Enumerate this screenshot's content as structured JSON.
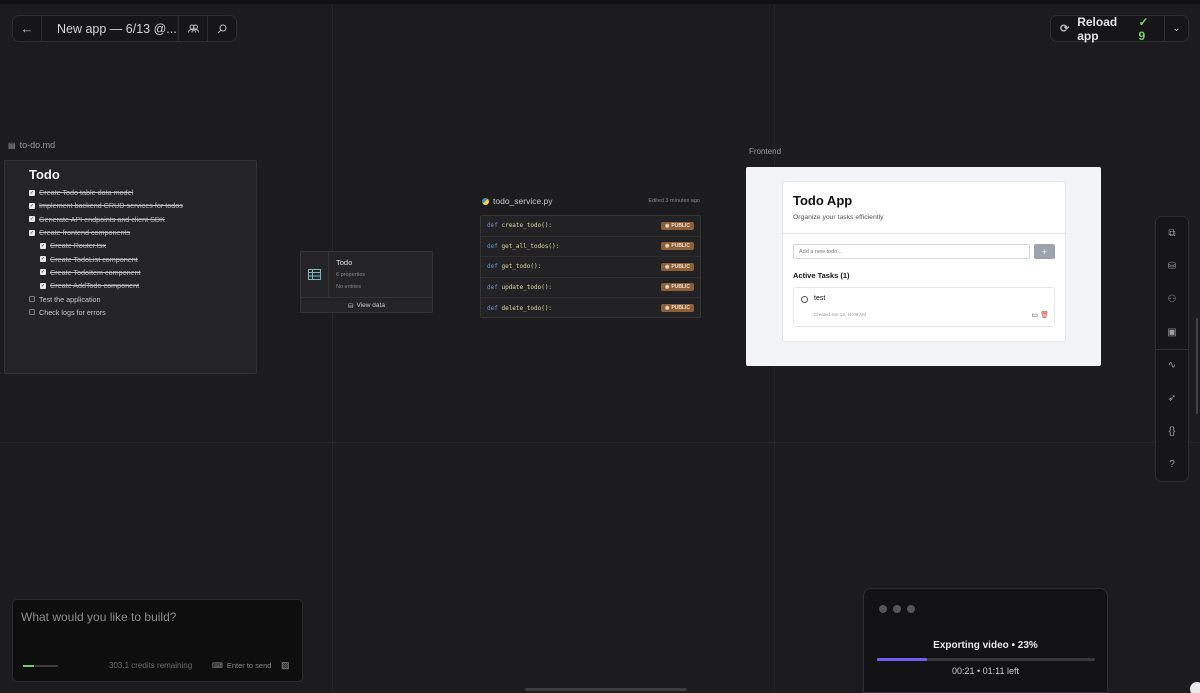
{
  "topbar": {
    "app_title": "New app — 6/13 @..."
  },
  "reload": {
    "label": "Reload app",
    "count": "9"
  },
  "markdown_node": {
    "filename": "to-do.md",
    "title": "Todo",
    "items": [
      {
        "text": "Create Todo table data model",
        "done": true,
        "sub": false
      },
      {
        "text": "Implement backend CRUD services for todos",
        "done": true,
        "sub": false
      },
      {
        "text": "Generate API endpoints and client SDK",
        "done": true,
        "sub": false
      },
      {
        "text": "Create frontend components",
        "done": true,
        "sub": false
      },
      {
        "text": "Create Router.tsx",
        "done": true,
        "sub": true
      },
      {
        "text": "Create TodoList component",
        "done": true,
        "sub": true
      },
      {
        "text": "Create TodoItem component",
        "done": true,
        "sub": true
      },
      {
        "text": "Create AddTodo component",
        "done": true,
        "sub": true
      },
      {
        "text": "Test the application",
        "done": false,
        "sub": false
      },
      {
        "text": "Check logs for errors",
        "done": false,
        "sub": false
      }
    ]
  },
  "table_node": {
    "name": "Todo",
    "properties": "6 properties",
    "entries": "No entries",
    "view_label": "View data"
  },
  "service_node": {
    "filename": "todo_service.py",
    "edited": "Edited 3 minutes ago",
    "keyword": "def",
    "badge": "PUBLIC",
    "functions": [
      "create_todo():",
      "get_all_todos():",
      "get_todo():",
      "update_todo():",
      "delete_todo():"
    ]
  },
  "frontend": {
    "label": "Frontend",
    "app_title": "Todo App",
    "subtitle": "Organize your tasks efficiently",
    "input_placeholder": "Add a new todo...",
    "add_button": "+",
    "section_title": "Active Tasks (1)",
    "task_name": "test",
    "task_created": "Created Jun 13, 11:08 AM"
  },
  "prompt": {
    "placeholder": "What would you like to build?",
    "credits": "303.1 credits remaining",
    "send_hint": "Enter to send",
    "credits_fraction": 0.3
  },
  "export": {
    "title": "Exporting video • 23%",
    "progress": 0.23,
    "time": "00:21 • 01:11 left"
  },
  "colors": {
    "accent_green": "#7ccf6e",
    "progress_purple": "#6e5cf5",
    "badge_brown": "#8a5f3a"
  },
  "icons": {
    "topbar": [
      "back-arrow-icon",
      "app-logo-icon",
      "users-icon",
      "search-icon"
    ],
    "rail": [
      "frame-icon",
      "database-icon",
      "users-icon",
      "image-icon",
      "activity-icon",
      "rocket-icon",
      "braces-icon",
      "help-icon"
    ]
  }
}
